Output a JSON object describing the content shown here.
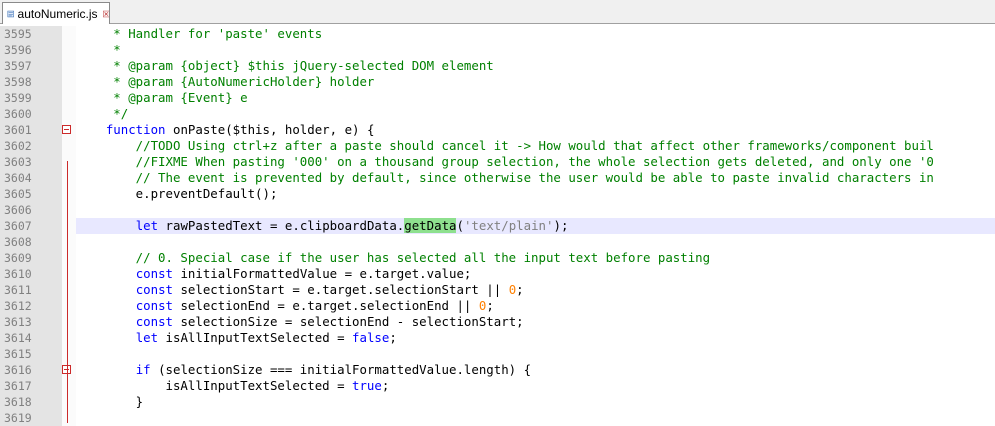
{
  "tab": {
    "filename": "autoNumeric.js",
    "icon": "js-file-icon",
    "close_icon": "close-icon"
  },
  "colors": {
    "comment": "#008000",
    "keyword": "#0000ff",
    "string": "#808080",
    "number": "#ff8000",
    "operator": "#000080",
    "highlight": "#8ee08e",
    "current_line": "#e8e8ff",
    "fold_marker": "#cc2a2a"
  },
  "current_line_number": "3607",
  "lines": [
    {
      "n": "3595",
      "code": "     * Handler for 'paste' events",
      "kind": "comment"
    },
    {
      "n": "3596",
      "code": "     *",
      "kind": "comment"
    },
    {
      "n": "3597",
      "code": "     * @param {object} $this jQuery-selected DOM element",
      "kind": "comment"
    },
    {
      "n": "3598",
      "code": "     * @param {AutoNumericHolder} holder",
      "kind": "comment"
    },
    {
      "n": "3599",
      "code": "     * @param {Event} e",
      "kind": "comment"
    },
    {
      "n": "3600",
      "code": "     */",
      "kind": "comment"
    },
    {
      "n": "3601",
      "code": "    function onPaste($this, holder, e) {",
      "fold": true
    },
    {
      "n": "3602",
      "code": "        //TODO Using ctrl+z after a paste should cancel it -> How would that affect other frameworks/component buil",
      "kind": "comment"
    },
    {
      "n": "3603",
      "code": "        //FIXME When pasting '000' on a thousand group selection, the whole selection gets deleted, and only one '0",
      "kind": "comment"
    },
    {
      "n": "3604",
      "code": "        // The event is prevented by default, since otherwise the user would be able to paste invalid characters in",
      "kind": "comment"
    },
    {
      "n": "3605",
      "code": "        e.preventDefault();"
    },
    {
      "n": "3606",
      "code": ""
    },
    {
      "n": "3607",
      "code": "        let rawPastedText = e.clipboardData.getData('text/plain');"
    },
    {
      "n": "3608",
      "code": ""
    },
    {
      "n": "3609",
      "code": "        // 0. Special case if the user has selected all the input text before pasting",
      "kind": "comment"
    },
    {
      "n": "3610",
      "code": "        const initialFormattedValue = e.target.value;"
    },
    {
      "n": "3611",
      "code": "        const selectionStart = e.target.selectionStart || 0;"
    },
    {
      "n": "3612",
      "code": "        const selectionEnd = e.target.selectionEnd || 0;"
    },
    {
      "n": "3613",
      "code": "        const selectionSize = selectionEnd - selectionStart;"
    },
    {
      "n": "3614",
      "code": "        let isAllInputTextSelected = false;"
    },
    {
      "n": "3615",
      "code": ""
    },
    {
      "n": "3616",
      "code": "        if (selectionSize === initialFormattedValue.length) {",
      "fold": true
    },
    {
      "n": "3617",
      "code": "            isAllInputTextSelected = true;"
    },
    {
      "n": "3618",
      "code": "        }"
    },
    {
      "n": "3619",
      "code": ""
    }
  ]
}
